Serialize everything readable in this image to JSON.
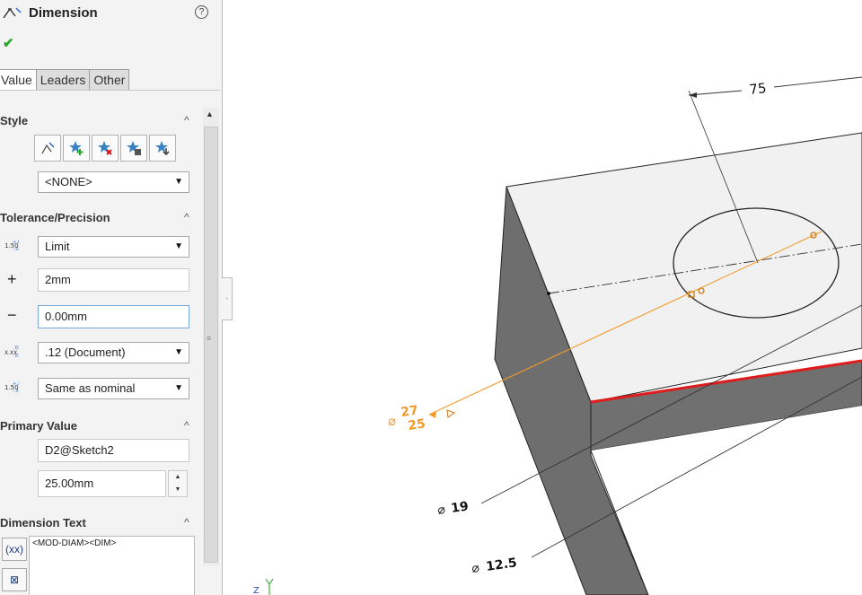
{
  "panel": {
    "title": "Dimension",
    "help_icon": "?",
    "tabs": [
      {
        "label": "Value"
      },
      {
        "label": "Leaders"
      },
      {
        "label": "Other"
      }
    ],
    "style": {
      "header": "Style",
      "icons": [
        "dimension-style-icon",
        "add-favorite-icon",
        "delete-favorite-icon",
        "save-favorite-icon",
        "load-favorite-icon"
      ],
      "dropdown_value": "<NONE>"
    },
    "tolerance": {
      "header": "Tolerance/Precision",
      "type_value": "Limit",
      "plus_label": "+",
      "plus_value": "2mm",
      "minus_label": "−",
      "minus_value": "0.00mm",
      "precision_value": ".12 (Document)",
      "tolerance_precision_value": "Same as nominal"
    },
    "primary": {
      "header": "Primary Value",
      "name_value": "D2@Sketch2",
      "value": "25.00mm"
    },
    "dimtext": {
      "header": "Dimension Text",
      "text": "<MOD-DIAM><DIM>"
    }
  },
  "viewport": {
    "dim_75": "75",
    "dim_upper": "27",
    "dim_lower": "25",
    "dim_19": "19",
    "dim_12_5": "12.5",
    "axis_label": "Z",
    "diam_symbol": "⌀",
    "colors": {
      "selection": "#f39a2b",
      "edge_highlight": "#e01b1b",
      "face_dark": "#6e6e6e",
      "face_light": "#f1f1f1"
    }
  }
}
